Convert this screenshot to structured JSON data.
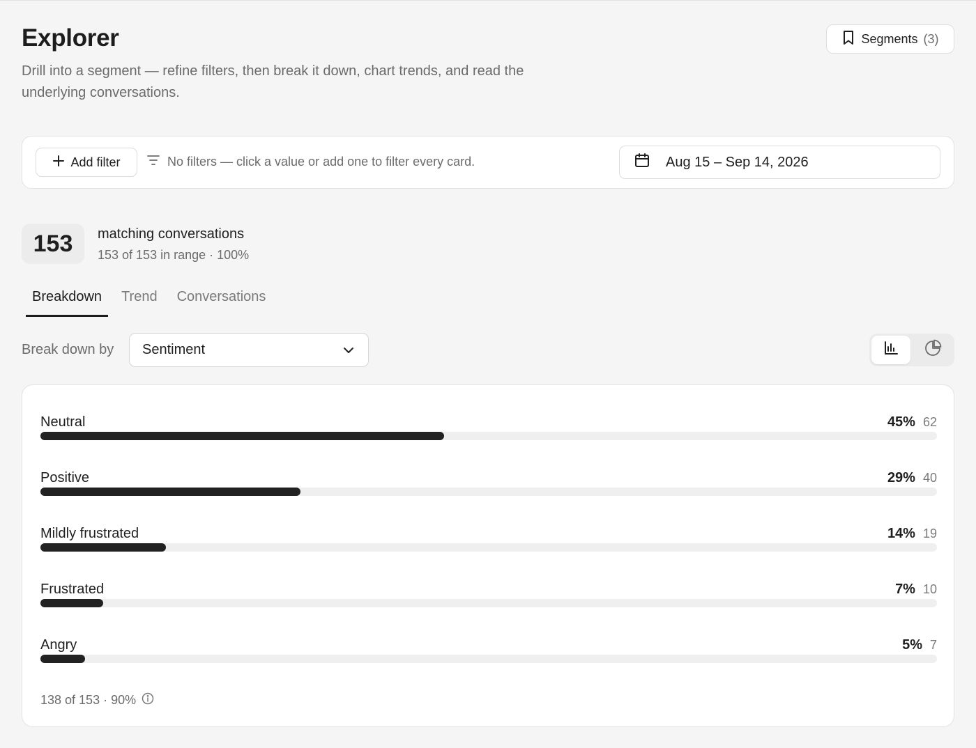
{
  "header": {
    "title": "Explorer",
    "subtitle": "Drill into a segment — refine filters, then break it down, chart trends, and read the underlying conversations.",
    "segments_label": "Segments",
    "segments_count": "(3)"
  },
  "filters": {
    "add_filter_label": "Add filter",
    "hint": "No filters — click a value or add one to filter every card.",
    "date_range": "Aug 15 – Sep 14, 2026"
  },
  "summary": {
    "count": "153",
    "label": "matching conversations",
    "sub": "153 of 153 in range · 100%"
  },
  "tabs": [
    {
      "label": "Breakdown",
      "active": true
    },
    {
      "label": "Trend",
      "active": false
    },
    {
      "label": "Conversations",
      "active": false
    }
  ],
  "breakdown": {
    "label": "Break down by",
    "selected": "Sentiment",
    "view_mode": "bar"
  },
  "chart_data": {
    "type": "bar",
    "orientation": "horizontal",
    "categories": [
      "Neutral",
      "Positive",
      "Mildly frustrated",
      "Frustrated",
      "Angry"
    ],
    "percent_labels": [
      "45%",
      "29%",
      "14%",
      "7%",
      "5%"
    ],
    "counts": [
      62,
      40,
      19,
      10,
      7
    ],
    "bar_fraction": [
      0.45,
      0.29,
      0.14,
      0.07,
      0.05
    ],
    "footnote": "138 of 153 · 90%",
    "colors": {
      "fill": "#222222",
      "track": "#efefef"
    }
  }
}
